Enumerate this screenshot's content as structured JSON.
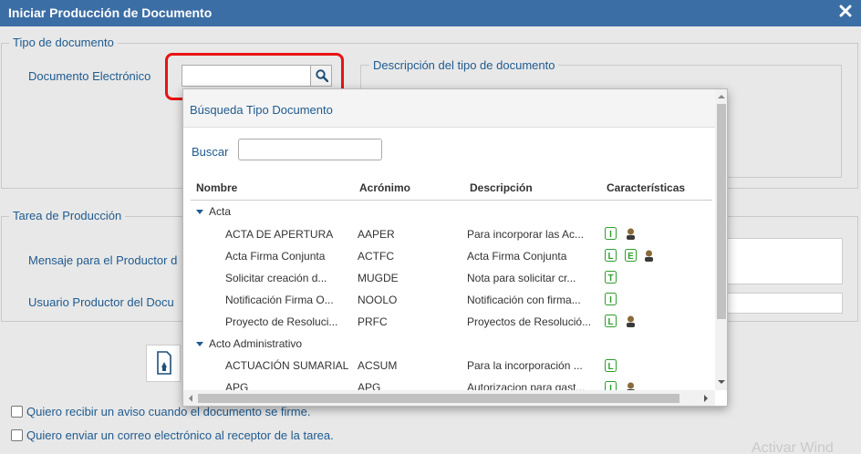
{
  "window": {
    "title": "Iniciar Producción de Documento",
    "close_icon": "close-icon"
  },
  "tipo_documento": {
    "legend": "Tipo de documento",
    "doc_label": "Documento Electrónico",
    "doc_value": "",
    "descripcion_legend": "Descripción del tipo de documento"
  },
  "tarea": {
    "legend": "Tarea de Producción",
    "mensaje_label": "Mensaje para el Productor d",
    "usuario_label": "Usuario Productor del Docu"
  },
  "popup": {
    "title": "Búsqueda Tipo Documento",
    "buscar_label": "Buscar",
    "buscar_value": "",
    "columns": [
      "Nombre",
      "Acrónimo",
      "Descripción",
      "Características"
    ],
    "groups": [
      {
        "name": "Acta",
        "rows": [
          {
            "nombre": "ACTA DE APERTURA",
            "acronimo": "AAPER",
            "descripcion": "Para incorporar las Ac...",
            "icons": [
              "i-icon",
              "user-icon"
            ]
          },
          {
            "nombre": "Acta Firma Conjunta",
            "acronimo": "ACTFC",
            "descripcion": "Acta Firma Conjunta",
            "icons": [
              "l-icon",
              "e-icon",
              "user-icon"
            ]
          },
          {
            "nombre": "Solicitar creación d...",
            "acronimo": "MUGDE",
            "descripcion": "Nota para solicitar cr...",
            "icons": [
              "t-icon"
            ]
          },
          {
            "nombre": "Notificación Firma O...",
            "acronimo": "NOOLO",
            "descripcion": "Notificación con firma...",
            "icons": [
              "i-icon"
            ]
          },
          {
            "nombre": "Proyecto de Resoluci...",
            "acronimo": "PRFC",
            "descripcion": "Proyectos de Resolució...",
            "icons": [
              "l-icon",
              "user-icon"
            ]
          }
        ]
      },
      {
        "name": "Acto Administrativo",
        "rows": [
          {
            "nombre": "ACTUACIÓN SUMARIAL",
            "acronimo": "ACSUM",
            "descripcion": "Para la incorporación ...",
            "icons": [
              "l-icon"
            ]
          },
          {
            "nombre": "APG",
            "acronimo": "APG",
            "descripcion": "Autorizacion para gast...",
            "icons": [
              "i-icon",
              "user-icon"
            ]
          }
        ]
      }
    ]
  },
  "checkboxes": {
    "aviso": "Quiero recibir un aviso cuando el documento se firme.",
    "correo": "Quiero enviar un correo electrónico al receptor de la tarea."
  },
  "watermark": "Activar Wind",
  "colors": {
    "titlebar": "#3c6ea6",
    "label": "#1f5b8f",
    "highlight": "#e81313",
    "icon_green": "#2e9e2e"
  }
}
